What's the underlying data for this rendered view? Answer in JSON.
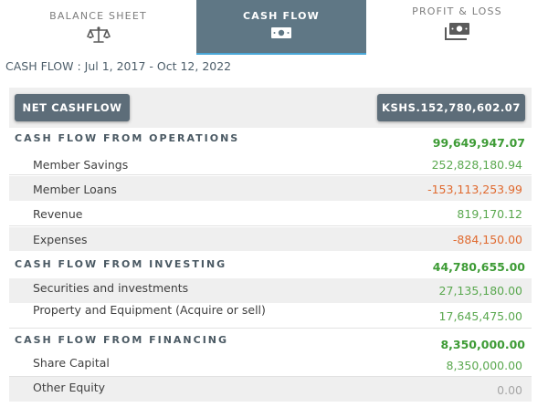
{
  "tabs": {
    "balance_sheet": "BALANCE SHEET",
    "cash_flow": "CASH FLOW",
    "profit_loss": "PROFIT & LOSS"
  },
  "icons": {
    "balance_sheet": "scales-icon",
    "cash_flow": "banknote-icon",
    "profit_loss": "stacked-banknotes-icon"
  },
  "period": "CASH FLOW : Jul 1, 2017 - Oct 12, 2022",
  "summary": {
    "net_label": "NET CASHFLOW",
    "net_value": "KSHS.152,780,602.07"
  },
  "operations": {
    "title": "CASH FLOW FROM OPERATIONS",
    "total": "99,649,947.07",
    "items": [
      {
        "label": "Member Savings",
        "value": "252,828,180.94"
      },
      {
        "label": "Member Loans",
        "value": "-153,113,253.99"
      },
      {
        "label": "Revenue",
        "value": "819,170.12"
      },
      {
        "label": "Expenses",
        "value": "-884,150.00"
      }
    ]
  },
  "investing": {
    "title": "CASH FLOW FROM INVESTING",
    "total": "44,780,655.00",
    "items": [
      {
        "label": "Securities and investments",
        "value": "27,135,180.00"
      },
      {
        "label": "Property and Equipment (Acquire or sell)",
        "value": "17,645,475.00"
      }
    ]
  },
  "financing": {
    "title": "CASH FLOW FROM FINANCING",
    "total": "8,350,000.00",
    "items": [
      {
        "label": "Share Capital",
        "value": "8,350,000.00"
      },
      {
        "label": "Other Equity",
        "value": "0.00"
      }
    ]
  },
  "colors": {
    "tab_active": "#5f7785",
    "tab_active_underline": "#49a7d8",
    "button": "#5d6d79",
    "section_total": "#3d9b35",
    "positive": "#5aa84f",
    "negative": "#e06a2f",
    "zero": "#a6a6a6"
  }
}
